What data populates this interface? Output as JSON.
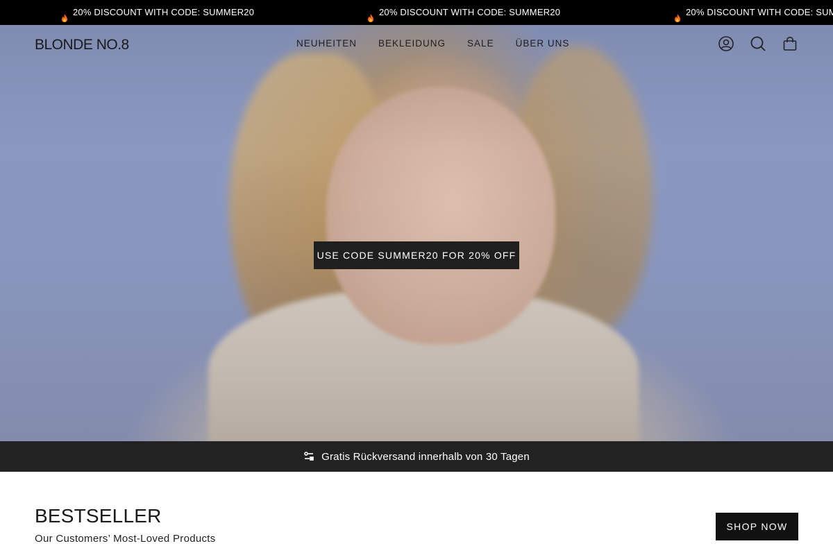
{
  "announcement": {
    "items": [
      {
        "icon": "flame-icon",
        "text": "20% DISCOUNT WITH CODE: SUMMER20"
      },
      {
        "icon": "flame-icon",
        "text": "20% DISCOUNT WITH CODE: SUMMER20"
      },
      {
        "icon": "flame-icon",
        "text": "20% DISCOUNT WITH CODE: SUMM"
      }
    ]
  },
  "header": {
    "logo": "BLONDE NO.8",
    "nav": [
      "NEUHEITEN",
      "BEKLEIDUNG",
      "SALE",
      "ÜBER UNS"
    ],
    "icons": [
      "account-icon",
      "search-icon",
      "cart-icon"
    ]
  },
  "hero": {
    "cta_label": "USE CODE SUMMER20 FOR 20% OFF"
  },
  "infobar": {
    "icon": "return-icon",
    "text": "Gratis Rückversand innerhalb von 30 Tagen"
  },
  "bestseller": {
    "title": "BESTSELLER",
    "subtitle": "Our Customers’ Most-Loved Products",
    "button_label": "SHOP NOW"
  },
  "colors": {
    "announcement_bg": "#000000",
    "infobar_bg": "#222222",
    "button_bg": "#111111",
    "hero_bg": "#8d9bc4"
  }
}
